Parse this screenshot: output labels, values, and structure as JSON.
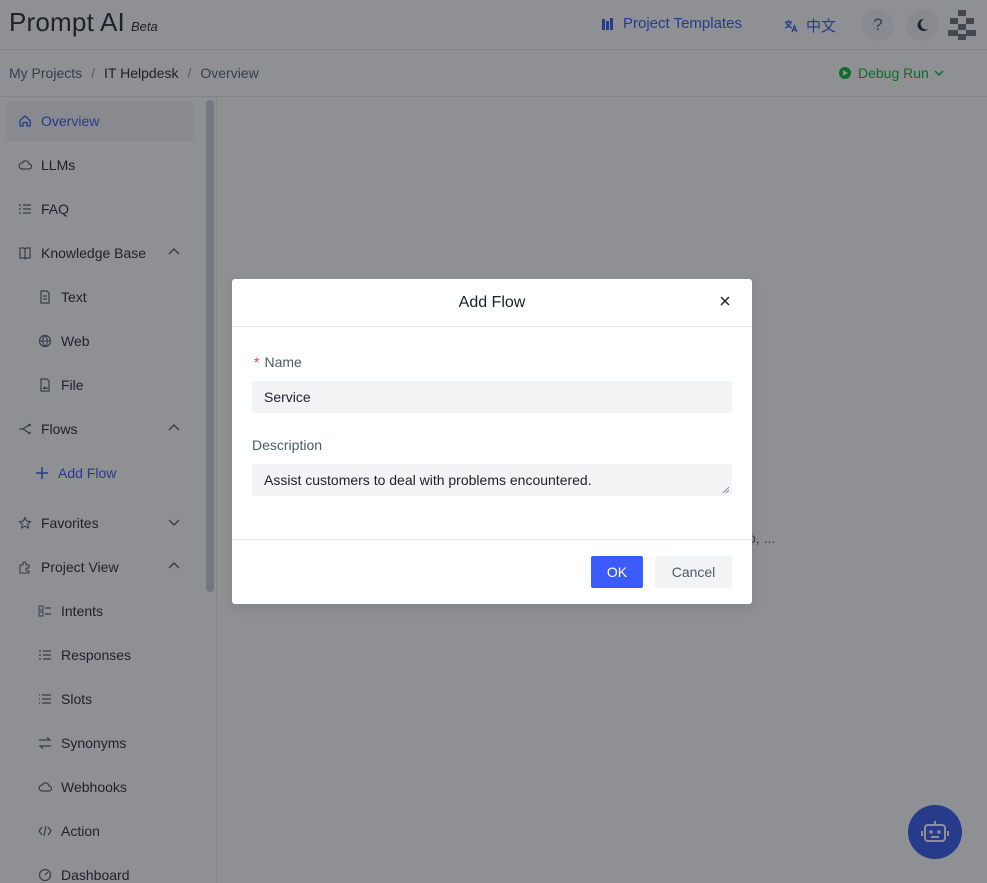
{
  "header": {
    "brand": "Prompt AI",
    "badge": "Beta",
    "templates_label": "Project Templates",
    "lang_label": "中文",
    "help_label": "?"
  },
  "breadcrumb": [
    "My Projects",
    "IT Helpdesk",
    "Overview"
  ],
  "debug_label": "Debug Run",
  "sidebar": {
    "items": [
      {
        "label": "Overview",
        "icon": "home-icon",
        "active": true
      },
      {
        "label": "LLMs",
        "icon": "cloud-icon"
      },
      {
        "label": "FAQ",
        "icon": "list-icon"
      },
      {
        "label": "Knowledge Base",
        "icon": "book-icon",
        "expanded": true
      },
      {
        "label": "Text",
        "icon": "document-icon"
      },
      {
        "label": "Web",
        "icon": "globe-icon"
      },
      {
        "label": "File",
        "icon": "file-image-icon"
      },
      {
        "label": "Flows",
        "icon": "flow-icon",
        "expanded": true
      },
      {
        "label": "Add Flow",
        "icon": "plus-icon"
      },
      {
        "label": "Favorites",
        "icon": "star-icon",
        "expanded": false
      },
      {
        "label": "Project View",
        "icon": "puzzle-icon",
        "expanded": true
      },
      {
        "label": "Intents",
        "icon": "intents-icon"
      },
      {
        "label": "Responses",
        "icon": "checklist-icon"
      },
      {
        "label": "Slots",
        "icon": "slots-icon"
      },
      {
        "label": "Synonyms",
        "icon": "swap-icon"
      },
      {
        "label": "Webhooks",
        "icon": "cloud-icon"
      },
      {
        "label": "Action",
        "icon": "code-icon"
      },
      {
        "label": "Dashboard",
        "icon": "dashboard-icon"
      }
    ]
  },
  "main": {
    "bg_text": "o, ..."
  },
  "modal": {
    "title": "Add Flow",
    "name_label": "Name",
    "name_value": "Service",
    "description_label": "Description",
    "description_value": "Assist customers to deal with problems encountered.",
    "ok_label": "OK",
    "cancel_label": "Cancel"
  },
  "colors": {
    "accent": "#2f54eb",
    "ok_button": "#3b5bfd",
    "debug": "#00b42a",
    "required": "#f53f3f"
  }
}
